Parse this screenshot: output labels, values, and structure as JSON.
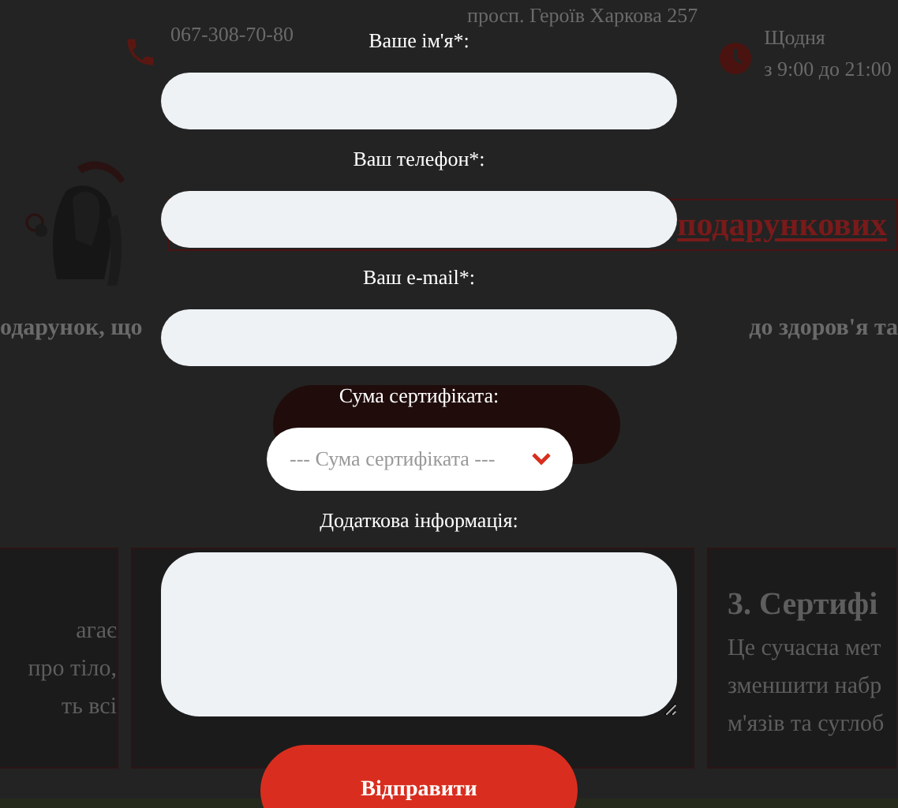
{
  "page": {
    "contacts": [
      {
        "kind": "phone",
        "lines": [
          "067-308-70-80"
        ]
      },
      {
        "kind": "pin",
        "lines": [
          "просп. Героїв Харкова 257"
        ]
      },
      {
        "kind": "clock",
        "lines": [
          "Щодня",
          "з 9:00 до 21:00"
        ]
      }
    ],
    "banner_heading": "подарункових",
    "tagline_left": "одарунок, що",
    "tagline_right": "до здоров'я та",
    "cards": [
      {
        "lines": [
          "агає",
          "про тіло,",
          "ть всі"
        ]
      },
      {
        "title": "3. Сертифі",
        "lines": [
          "Це сучасна мет",
          "зменшити набр",
          "м'язів та суглоб"
        ]
      }
    ]
  },
  "form": {
    "fields": [
      {
        "kind": "input",
        "label": "Ваше ім'я*:"
      },
      {
        "kind": "input",
        "label": "Ваш телефон*:"
      },
      {
        "kind": "input",
        "label": "Ваш e-mail*:"
      },
      {
        "kind": "select",
        "label": "Сума сертифіката:",
        "placeholder": "--- Сума сертифіката ---"
      },
      {
        "kind": "textarea",
        "label": "Додаткова інформація:"
      }
    ],
    "submit": "Відправити"
  }
}
